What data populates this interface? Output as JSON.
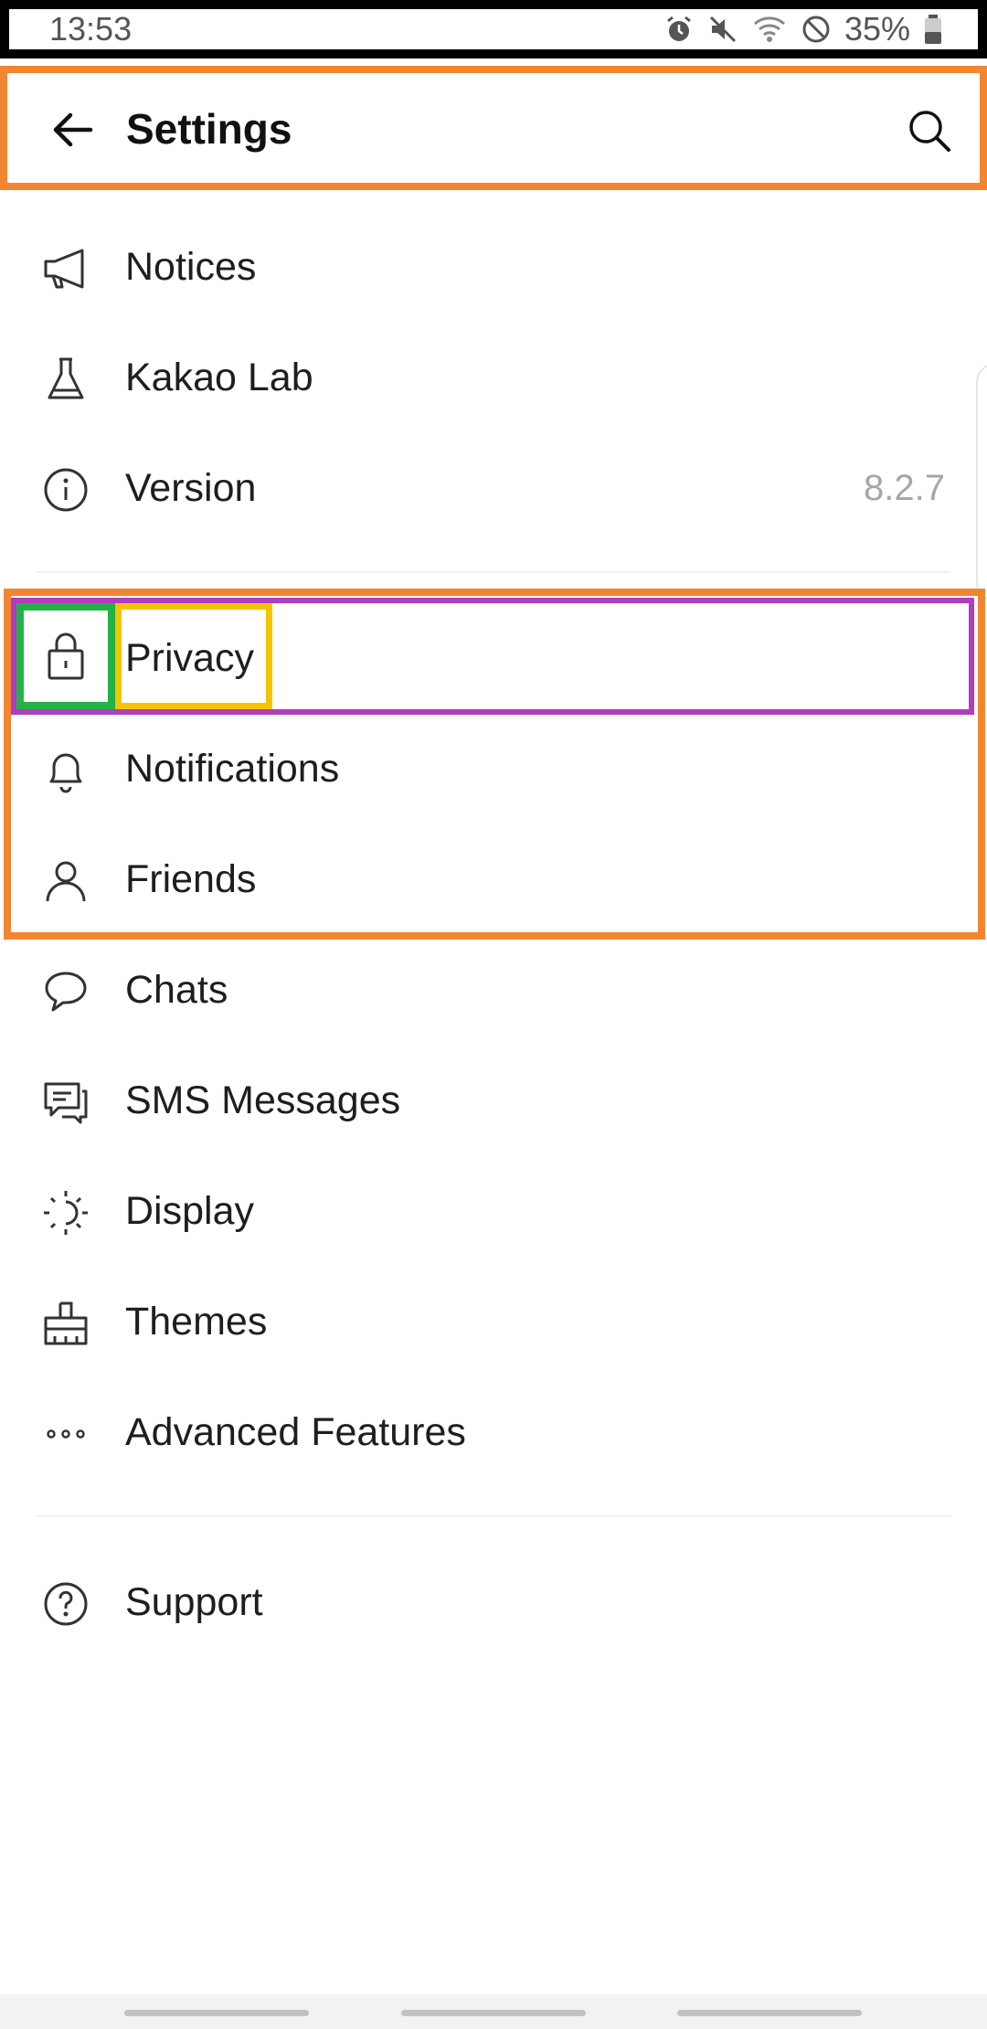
{
  "status_bar": {
    "time": "13:53",
    "battery": "35%",
    "icons": [
      "alarm-icon",
      "mute-icon",
      "wifi-icon",
      "do-not-disturb-icon",
      "battery-icon"
    ]
  },
  "header": {
    "title": "Settings",
    "back_icon": "arrow-left-icon",
    "search_icon": "search-icon"
  },
  "menu": {
    "section1": [
      {
        "label": "Notices",
        "icon": "megaphone-icon"
      },
      {
        "label": "Kakao Lab",
        "icon": "flask-icon"
      },
      {
        "label": "Version",
        "icon": "info-icon",
        "value": "8.2.7"
      }
    ],
    "section2": [
      {
        "label": "Privacy",
        "icon": "lock-icon"
      },
      {
        "label": "Notifications",
        "icon": "bell-icon"
      },
      {
        "label": "Friends",
        "icon": "person-icon"
      },
      {
        "label": "Chats",
        "icon": "chat-bubble-icon"
      },
      {
        "label": "SMS Messages",
        "icon": "sms-icon"
      },
      {
        "label": "Display",
        "icon": "display-brightness-icon"
      },
      {
        "label": "Themes",
        "icon": "brush-icon"
      },
      {
        "label": "Advanced Features",
        "icon": "more-dots-icon"
      }
    ],
    "section3": [
      {
        "label": "Support",
        "icon": "help-icon"
      }
    ]
  },
  "colors": {
    "highlight_orange": "#f28530",
    "highlight_purple": "#b23cc0",
    "highlight_green": "#22b347",
    "highlight_yellow": "#f5c400",
    "version_text": "#a6a6a6"
  }
}
